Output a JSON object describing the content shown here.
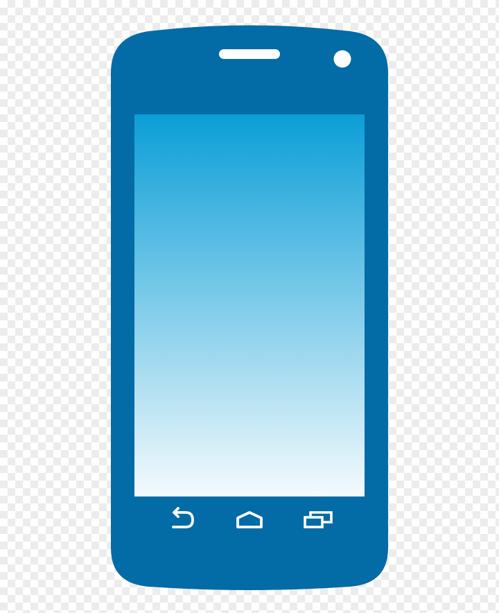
{
  "phone": {
    "body_color": "#036BA5",
    "speaker_color": "#FFFFFF",
    "camera_color": "#FFFFFF",
    "screen_gradient_top": "#0B9ED7",
    "screen_gradient_bottom": "#F4FAFD",
    "nav_icon_color": "#FFFFFF"
  },
  "nav_bar": {
    "buttons": [
      {
        "icon": "back-icon"
      },
      {
        "icon": "home-icon"
      },
      {
        "icon": "recent-apps-icon"
      }
    ]
  }
}
